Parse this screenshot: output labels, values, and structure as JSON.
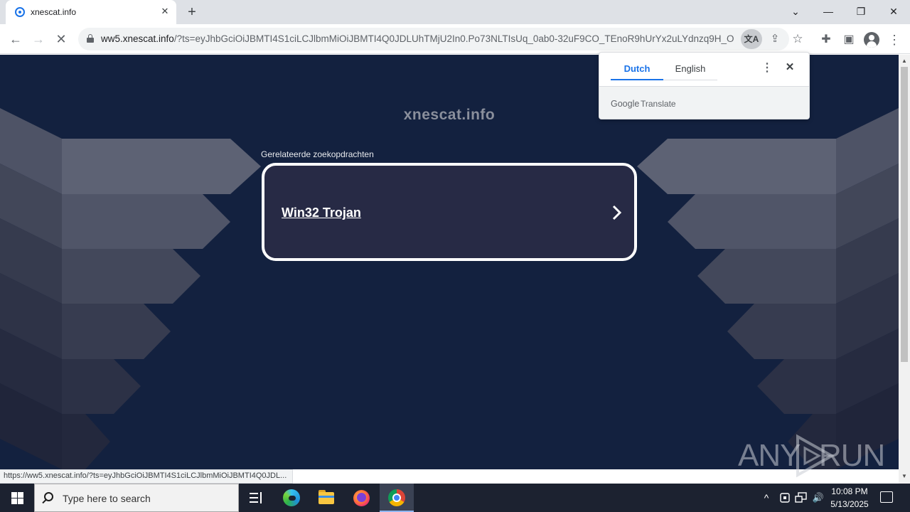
{
  "browser": {
    "tab": {
      "title": "xnescat.info",
      "close": "✕"
    },
    "new_tab": "+",
    "window_controls": {
      "tab_search": "⌄",
      "minimize": "—",
      "restore": "❐",
      "close": "✕"
    },
    "nav": {
      "back": "←",
      "forward": "→",
      "reload": "✕"
    },
    "address": {
      "domain": "ww5.xnescat.info",
      "path": "/?ts=eyJhbGciOiJBMTI4S1ciLCJlbmMiOiJBMTI4Q0JDLUhTMjU2In0.Po73NLTIsUq_0ab0-32uF9CO_TEnoR9hUrYx2uLYdnzq9H_O..."
    },
    "icons": {
      "translate": "translate-icon",
      "share": "share-icon",
      "bookmark": "star-icon",
      "extensions": "puzzle-icon",
      "side_panel": "side-panel-icon",
      "profile": "profile-icon",
      "menu": "kebab-menu-icon"
    },
    "glyphs": {
      "translate": "文A",
      "share": "⇪",
      "star": "☆",
      "puzzle": "✚",
      "side_panel": "▣",
      "menu": "⋮"
    }
  },
  "page": {
    "site_title": "xnescat.info",
    "related_label": "Gerelateerde zoekopdrachten",
    "related_link": "Win32 Trojan",
    "colors": {
      "background": "#13213f",
      "card": "#272a45",
      "card_border": "#ffffff"
    }
  },
  "status_bar": {
    "url": "https://ww5.xnescat.info/?ts=eyJhbGciOiJBMTI4S1ciLCJlbmMiOiJBMTI4Q0JDL..."
  },
  "translate_popup": {
    "source_language": "Dutch",
    "target_language": "English",
    "menu": "⋮",
    "close": "✕",
    "brand_google": "Google",
    "brand_translate": "Translate",
    "accent": "#1a73e8"
  },
  "watermark": {
    "left": "ANY",
    "right": "RUN"
  },
  "taskbar": {
    "search_placeholder": "Type here to search",
    "apps": [
      "task-view",
      "edge",
      "file-explorer",
      "firefox",
      "chrome"
    ],
    "tray": {
      "chevron": "^",
      "volume": "🔊"
    },
    "clock": {
      "time": "10:08 PM",
      "date": "5/13/2025"
    }
  }
}
